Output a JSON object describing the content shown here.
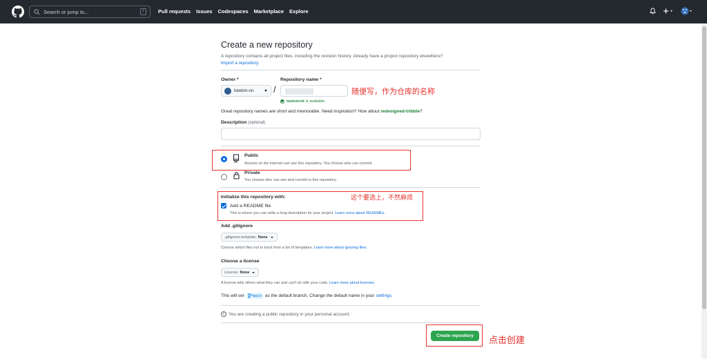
{
  "header": {
    "search_placeholder": "Search or jump to...",
    "search_shortcut": "/",
    "nav": [
      "Pull requests",
      "Issues",
      "Codespaces",
      "Marketplace",
      "Explore"
    ]
  },
  "page": {
    "title": "Create a new repository",
    "subtitle": "A repository contains all project files, including the revision history. Already have a project repository elsewhere?",
    "import_link": "Import a repository."
  },
  "form": {
    "owner_label": "Owner *",
    "owner_value": "lowion-cn",
    "separator": "/",
    "repo_label": "Repository name *",
    "repo_annotation": "随便写，作为仓库的名称",
    "available_name": "testcercel",
    "available_text": "is available.",
    "great_prefix": "Great repository names are short and memorable. Need inspiration? How about ",
    "great_suggestion": "redesigned-tribble",
    "great_suffix": "?",
    "description_label": "Description",
    "description_optional": "(optional)",
    "visibility": [
      {
        "title": "Public",
        "desc": "Anyone on the internet can see this repository. You choose who can commit.",
        "selected": true
      },
      {
        "title": "Private",
        "desc": "You choose who can see and commit to this repository.",
        "selected": false
      }
    ],
    "init_label": "Initialize this repository with:",
    "init_annotation": "这个要选上，不然麻烦",
    "readme_label": "Add a README file",
    "readme_desc": "This is where you can write a long description for your project.",
    "readme_link": "Learn more about READMEs.",
    "gitignore_label": "Add .gitignore",
    "gitignore_select_prefix": ".gitignore template:",
    "gitignore_select_value": "None",
    "gitignore_desc": "Choose which files not to track from a list of templates.",
    "gitignore_link": "Learn more about ignoring files.",
    "license_label": "Choose a license",
    "license_select_prefix": "License:",
    "license_select_value": "None",
    "license_desc": "A license tells others what they can and can't do with your code.",
    "license_link": "Learn more about licenses.",
    "branch_prefix": "This will set",
    "branch_name": "main",
    "branch_suffix": "as the default branch. Change the default name in your",
    "branch_link": "settings",
    "branch_end": ".",
    "info_text": "You are creating a public repository in your personal account.",
    "create_button": "Create repository",
    "create_annotation": "点击创建"
  },
  "colors": {
    "header_bg": "#24292f",
    "accent": "#0969da",
    "success": "#2da44e",
    "annotation_red": "#e5322d"
  }
}
